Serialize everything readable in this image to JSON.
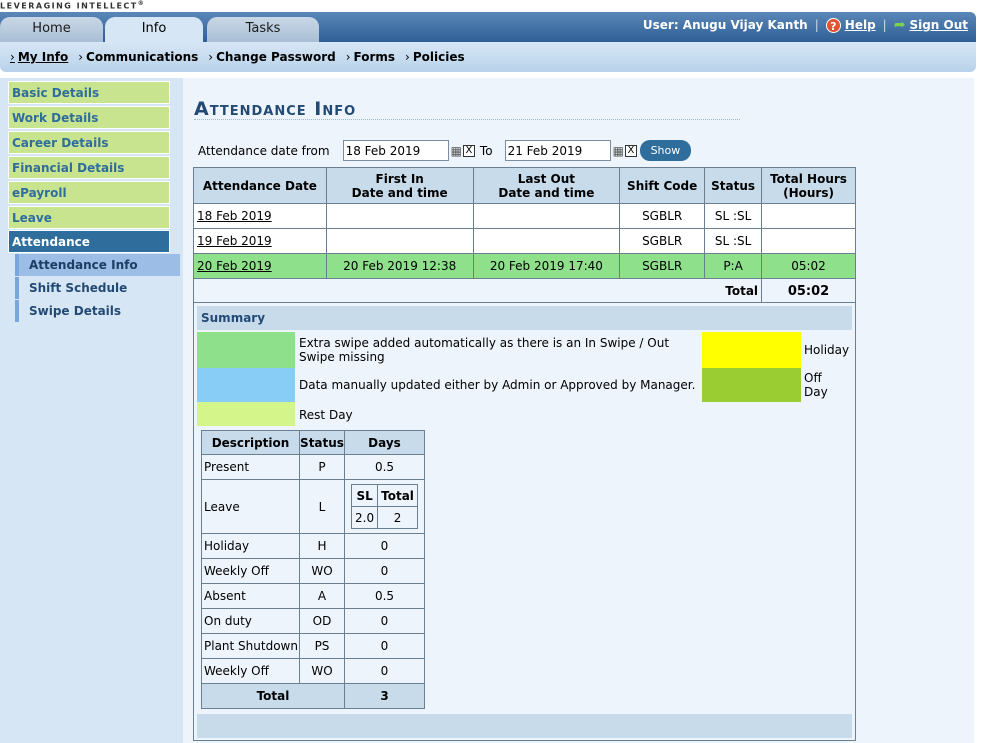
{
  "brand": {
    "tagline": "LEVERAGING INTELLECT",
    "mark": "®"
  },
  "tabs": {
    "home": "Home",
    "info": "Info",
    "tasks": "Tasks"
  },
  "user": {
    "label": "User: Anugu Vijay Kanth",
    "help": "Help",
    "signout": "Sign Out",
    "sep": "|"
  },
  "subnav": {
    "my_info": "My Info",
    "communications": "Communications",
    "change_password": "Change Password",
    "forms": "Forms",
    "policies": "Policies"
  },
  "sidebar": {
    "items": [
      "Basic Details",
      "Work Details",
      "Career Details",
      "Financial Details",
      "ePayroll",
      "Leave",
      "Attendance"
    ],
    "subitems": [
      "Attendance Info",
      "Shift Schedule",
      "Swipe Details"
    ]
  },
  "page": {
    "title": "Attendance Info"
  },
  "filter": {
    "from_label": "Attendance date from",
    "from_value": "18 Feb 2019",
    "to_label": "To",
    "to_value": "21 Feb 2019",
    "show": "Show",
    "clear": "X"
  },
  "attendance_table": {
    "headers": {
      "date": "Attendance Date",
      "first_in_1": "First In",
      "first_in_2": "Date and time",
      "last_out_1": "Last Out",
      "last_out_2": "Date and time",
      "shift": "Shift Code",
      "status": "Status",
      "total_1": "Total Hours",
      "total_2": "(Hours)"
    },
    "rows": [
      {
        "date": "18 Feb 2019",
        "first_in": "",
        "last_out": "",
        "shift": "SGBLR",
        "status": "SL :SL",
        "hours": ""
      },
      {
        "date": "19 Feb 2019",
        "first_in": "",
        "last_out": "",
        "shift": "SGBLR",
        "status": "SL :SL",
        "hours": ""
      },
      {
        "date": "20 Feb 2019",
        "first_in": "20 Feb 2019   12:38",
        "last_out": "20 Feb 2019   17:40",
        "shift": "SGBLR",
        "status": "P:A",
        "hours": "05:02"
      }
    ],
    "total_label": "Total",
    "total_value": "05:02"
  },
  "summary": {
    "heading": "Summary",
    "legend": {
      "extra_swipe": "Extra swipe added automatically as there is an In Swipe / Out Swipe missing",
      "manual": "Data manually updated either by Admin or Approved by Manager.",
      "rest": "Rest Day",
      "holiday": "Holiday",
      "off_day": "Off Day"
    },
    "colors": {
      "extra_swipe": "#8ee08a",
      "manual": "#87cdf5",
      "rest": "#d4f58a",
      "holiday": "#ffff00",
      "off_day": "#9acd32"
    },
    "stats_headers": {
      "description": "Description",
      "status": "Status",
      "days": "Days"
    },
    "stats": [
      {
        "desc": "Present",
        "status": "P",
        "days": "0.5"
      },
      {
        "desc": "Leave",
        "status": "L",
        "days": ""
      },
      {
        "desc": "Holiday",
        "status": "H",
        "days": "0"
      },
      {
        "desc": "Weekly Off",
        "status": "WO",
        "days": "0"
      },
      {
        "desc": "Absent",
        "status": "A",
        "days": "0.5"
      },
      {
        "desc": "On duty",
        "status": "OD",
        "days": "0"
      },
      {
        "desc": "Plant Shutdown",
        "status": "PS",
        "days": "0"
      },
      {
        "desc": "Weekly Off",
        "status": "WO",
        "days": "0"
      }
    ],
    "leave_breakdown": {
      "h1": "SL",
      "h2": "Total",
      "v1": "2.0",
      "v2": "2"
    },
    "total_label": "Total",
    "total_value": "3"
  }
}
